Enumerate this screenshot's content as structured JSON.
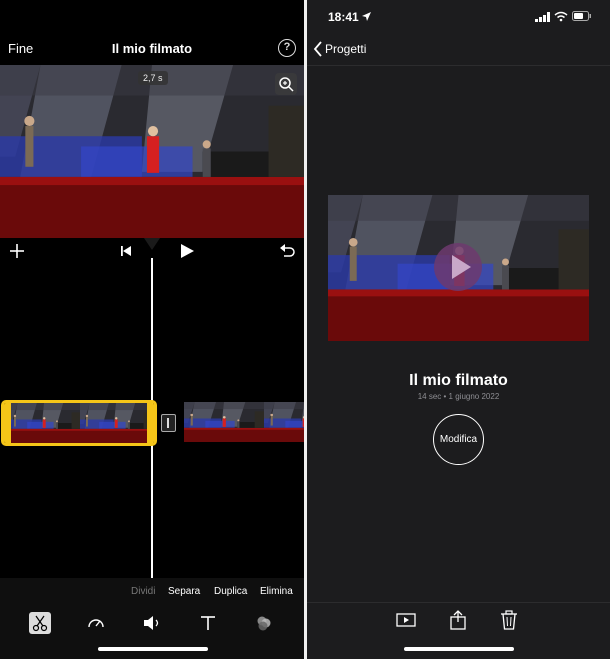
{
  "editor": {
    "done_label": "Fine",
    "title": "Il mio filmato",
    "help_label": "?",
    "duration_badge": "2,7 s",
    "actions": {
      "split": "Dividi",
      "separate": "Separa",
      "duplicate": "Duplica",
      "delete": "Elimina"
    },
    "tools": [
      "scissors-icon",
      "speed-icon",
      "volume-icon",
      "text-icon",
      "filters-icon"
    ],
    "accent_color": "#f5c518"
  },
  "project": {
    "status_time": "18:41",
    "back_label": "Progetti",
    "title": "Il mio filmato",
    "meta": "14 sec • 1 giugno 2022",
    "edit_label": "Modifica"
  }
}
